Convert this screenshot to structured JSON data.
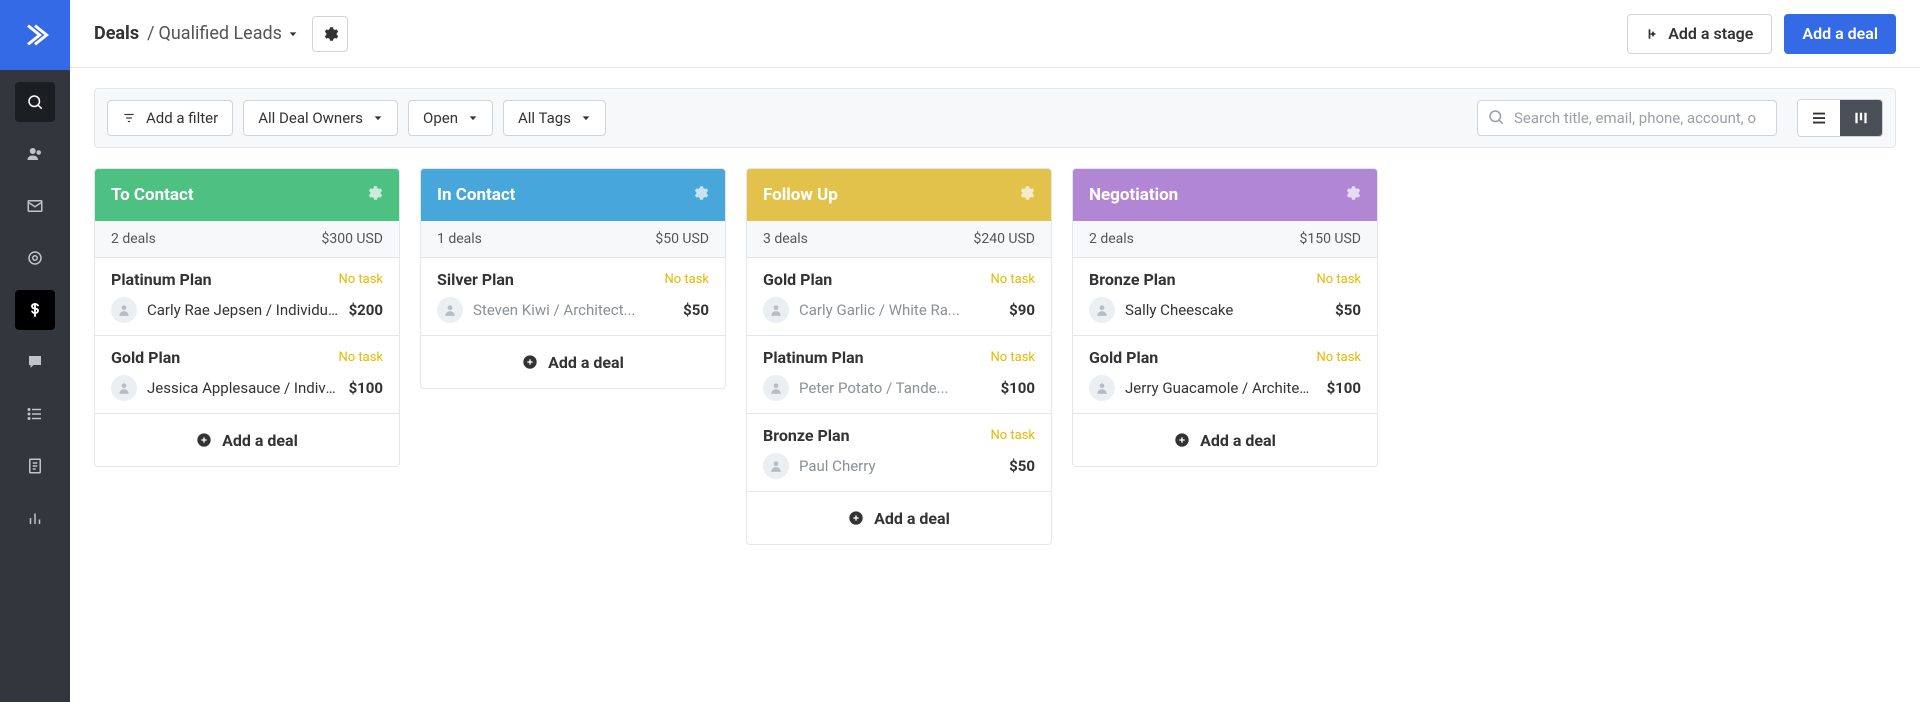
{
  "breadcrumb": {
    "root": "Deals",
    "sep": "/",
    "current": "Qualified Leads"
  },
  "header": {
    "add_stage": "Add a stage",
    "add_deal": "Add a deal"
  },
  "filters": {
    "add_filter": "Add a filter",
    "owner": "All Deal Owners",
    "status": "Open",
    "tags": "All Tags",
    "search_placeholder": "Search title, email, phone, account, o"
  },
  "add_deal_label": "Add a deal",
  "stages": [
    {
      "name": "To Contact",
      "color": "c-green",
      "count": "2 deals",
      "total": "$300 USD",
      "cards": [
        {
          "title": "Platinum Plan",
          "task": "No task",
          "contact": "Carly Rae Jepsen / Individual I",
          "amount": "$200",
          "dark": true
        },
        {
          "title": "Gold Plan",
          "task": "No task",
          "contact": "Jessica Applesauce / Individua",
          "amount": "$100",
          "dark": true
        }
      ]
    },
    {
      "name": "In Contact",
      "color": "c-blue",
      "count": "1 deals",
      "total": "$50 USD",
      "cards": [
        {
          "title": "Silver Plan",
          "task": "No task",
          "contact": "Steven Kiwi / Architect...",
          "amount": "$50",
          "dark": false
        }
      ]
    },
    {
      "name": "Follow Up",
      "color": "c-yellow",
      "count": "3 deals",
      "total": "$240 USD",
      "cards": [
        {
          "title": "Gold Plan",
          "task": "No task",
          "contact": "Carly Garlic / White Ra...",
          "amount": "$90",
          "dark": false
        },
        {
          "title": "Platinum Plan",
          "task": "No task",
          "contact": "Peter Potato / Tande...",
          "amount": "$100",
          "dark": false
        },
        {
          "title": "Bronze Plan",
          "task": "No task",
          "contact": "Paul Cherry",
          "amount": "$50",
          "dark": false
        }
      ]
    },
    {
      "name": "Negotiation",
      "color": "c-purple",
      "count": "2 deals",
      "total": "$150 USD",
      "cards": [
        {
          "title": "Bronze Plan",
          "task": "No task",
          "contact": "Sally Cheescake",
          "amount": "$50",
          "dark": true
        },
        {
          "title": "Gold Plan",
          "task": "No task",
          "contact": "Jerry Guacamole / Architect's",
          "amount": "$100",
          "dark": true
        }
      ]
    }
  ]
}
